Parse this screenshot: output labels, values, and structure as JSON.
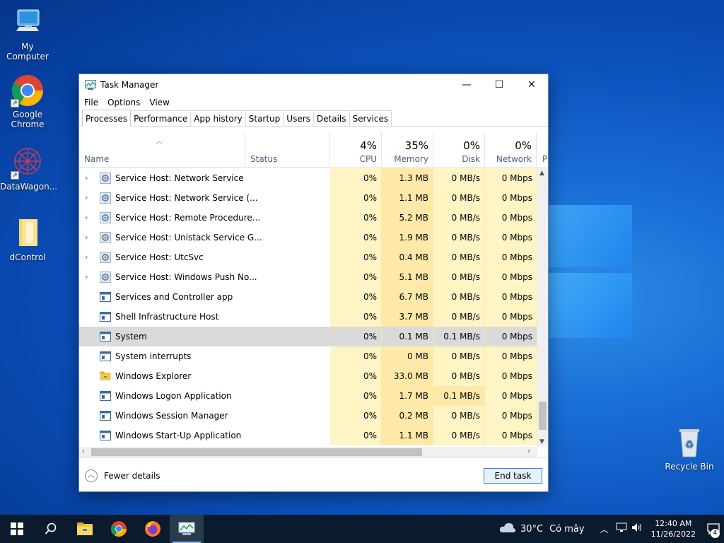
{
  "desktop": {
    "icons": [
      {
        "label": "My Computer"
      },
      {
        "label": "Google Chrome"
      },
      {
        "label": "DataWagon..."
      },
      {
        "label": "dControl"
      },
      {
        "label": "Recycle Bin"
      }
    ]
  },
  "window": {
    "title": "Task Manager",
    "controls": {
      "minimize": "—",
      "maximize": "☐",
      "close": "✕"
    },
    "menu": [
      "File",
      "Options",
      "View"
    ],
    "tabs": [
      "Processes",
      "Performance",
      "App history",
      "Startup",
      "Users",
      "Details",
      "Services"
    ],
    "active_tab": "Processes",
    "columns": {
      "name": {
        "label": "Name"
      },
      "status": {
        "label": "Status"
      },
      "cpu": {
        "pct": "4%",
        "label": "CPU"
      },
      "memory": {
        "pct": "35%",
        "label": "Memory"
      },
      "disk": {
        "pct": "0%",
        "label": "Disk"
      },
      "network": {
        "pct": "0%",
        "label": "Network"
      },
      "power": {
        "label": "P"
      }
    },
    "processes": [
      {
        "name": "Service Host: Network Service",
        "cpu": "0%",
        "memory": "1.3 MB",
        "disk": "0 MB/s",
        "network": "0 Mbps",
        "expandable": true,
        "icon": "gear-icon"
      },
      {
        "name": "Service Host: Network Service (...",
        "cpu": "0%",
        "memory": "1.1 MB",
        "disk": "0 MB/s",
        "network": "0 Mbps",
        "expandable": true,
        "icon": "gear-icon"
      },
      {
        "name": "Service Host: Remote Procedure...",
        "cpu": "0%",
        "memory": "5.2 MB",
        "disk": "0 MB/s",
        "network": "0 Mbps",
        "expandable": true,
        "icon": "gear-icon"
      },
      {
        "name": "Service Host: Unistack Service G...",
        "cpu": "0%",
        "memory": "1.9 MB",
        "disk": "0 MB/s",
        "network": "0 Mbps",
        "expandable": true,
        "icon": "gear-icon"
      },
      {
        "name": "Service Host: UtcSvc",
        "cpu": "0%",
        "memory": "0.4 MB",
        "disk": "0 MB/s",
        "network": "0 Mbps",
        "expandable": true,
        "icon": "gear-icon"
      },
      {
        "name": "Service Host: Windows Push No...",
        "cpu": "0%",
        "memory": "5.1 MB",
        "disk": "0 MB/s",
        "network": "0 Mbps",
        "expandable": true,
        "icon": "gear-icon"
      },
      {
        "name": "Services and Controller app",
        "cpu": "0%",
        "memory": "6.7 MB",
        "disk": "0 MB/s",
        "network": "0 Mbps",
        "expandable": false,
        "icon": "window-icon"
      },
      {
        "name": "Shell Infrastructure Host",
        "cpu": "0%",
        "memory": "3.7 MB",
        "disk": "0 MB/s",
        "network": "0 Mbps",
        "expandable": false,
        "icon": "window-icon"
      },
      {
        "name": "System",
        "cpu": "0%",
        "memory": "0.1 MB",
        "disk": "0.1 MB/s",
        "network": "0 Mbps",
        "expandable": false,
        "icon": "window-icon",
        "selected": true
      },
      {
        "name": "System interrupts",
        "cpu": "0%",
        "memory": "0 MB",
        "disk": "0 MB/s",
        "network": "0 Mbps",
        "expandable": false,
        "icon": "window-icon"
      },
      {
        "name": "Windows Explorer",
        "cpu": "0%",
        "memory": "33.0 MB",
        "disk": "0 MB/s",
        "network": "0 Mbps",
        "expandable": false,
        "icon": "folder-icon"
      },
      {
        "name": "Windows Logon Application",
        "cpu": "0%",
        "memory": "1.7 MB",
        "disk": "0.1 MB/s",
        "network": "0 Mbps",
        "expandable": false,
        "icon": "window-icon"
      },
      {
        "name": "Windows Session Manager",
        "cpu": "0%",
        "memory": "0.2 MB",
        "disk": "0 MB/s",
        "network": "0 Mbps",
        "expandable": false,
        "icon": "window-icon"
      },
      {
        "name": "Windows Start-Up Application",
        "cpu": "0%",
        "memory": "1.1 MB",
        "disk": "0 MB/s",
        "network": "0 Mbps",
        "expandable": false,
        "icon": "window-icon"
      }
    ],
    "footer": {
      "fewer_details": "Fewer details",
      "end_task": "End task"
    }
  },
  "taskbar": {
    "weather": {
      "temp": "30°C",
      "condition": "Có mây"
    },
    "clock": {
      "time": "12:40 AM",
      "date": "11/26/2022"
    },
    "notification_count": "4",
    "accent": "#0b1a2c"
  }
}
